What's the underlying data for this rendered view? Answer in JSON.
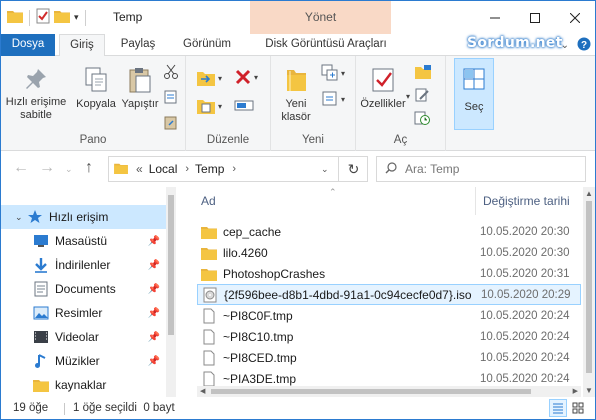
{
  "window": {
    "title": "Temp",
    "context_tab": "Yönet",
    "brand": "Sordum.net"
  },
  "ribbon_tabs": [
    "Dosya",
    "Giriş",
    "Paylaş",
    "Görünüm",
    "Disk Görüntüsü Araçları"
  ],
  "ribbon": {
    "pano": {
      "label": "Pano",
      "pin": "Hızlı erişime sabitle",
      "copy": "Kopyala",
      "paste": "Yapıştır"
    },
    "duzenle": {
      "label": "Düzenle"
    },
    "yeni": {
      "label": "Yeni",
      "new_folder": "Yeni klasör"
    },
    "ac": {
      "label": "Aç",
      "properties": "Özellikler"
    },
    "sec": {
      "label": "Seç"
    }
  },
  "address": {
    "prefix": "«",
    "segments": [
      "Local",
      "Temp"
    ],
    "search_placeholder": "Ara: Temp"
  },
  "nav_pane": {
    "items": [
      {
        "label": "Hızlı erişim",
        "icon": "star-icon",
        "pinned": false,
        "selected": true
      },
      {
        "label": "Masaüstü",
        "icon": "desktop-icon",
        "pinned": true
      },
      {
        "label": "İndirilenler",
        "icon": "download-icon",
        "pinned": true
      },
      {
        "label": "Documents",
        "icon": "document-icon",
        "pinned": true
      },
      {
        "label": "Resimler",
        "icon": "pictures-icon",
        "pinned": true
      },
      {
        "label": "Videolar",
        "icon": "video-icon",
        "pinned": true
      },
      {
        "label": "Müzikler",
        "icon": "music-icon",
        "pinned": true
      },
      {
        "label": "kaynaklar",
        "icon": "folder-icon",
        "pinned": false
      }
    ]
  },
  "file_list": {
    "columns": {
      "name": "Ad",
      "date": "Değiştirme tarihi"
    },
    "rows": [
      {
        "name": "cep_cache",
        "date": "10.05.2020 20:30",
        "type": "folder"
      },
      {
        "name": "lilo.4260",
        "date": "10.05.2020 20:30",
        "type": "folder"
      },
      {
        "name": "PhotoshopCrashes",
        "date": "10.05.2020 20:31",
        "type": "folder"
      },
      {
        "name": "{2f596bee-d8b1-4dbd-91a1-0c94cecfe0d7}.iso",
        "date": "10.05.2020 20:29",
        "type": "iso",
        "selected": true
      },
      {
        "name": "~PI8C0F.tmp",
        "date": "10.05.2020 20:24",
        "type": "file"
      },
      {
        "name": "~PI8C10.tmp",
        "date": "10.05.2020 20:24",
        "type": "file"
      },
      {
        "name": "~PI8CED.tmp",
        "date": "10.05.2020 20:24",
        "type": "file"
      },
      {
        "name": "~PIA3DE.tmp",
        "date": "10.05.2020 20:24",
        "type": "file"
      }
    ]
  },
  "status": {
    "count": "19 öğe",
    "selection": "1 öğe seçildi  0 bayt"
  },
  "colors": {
    "file_tab": "#1e6fbe",
    "context_tab": "#f9d9c6",
    "selection": "#cce8ff",
    "folder": "#f4c542"
  }
}
